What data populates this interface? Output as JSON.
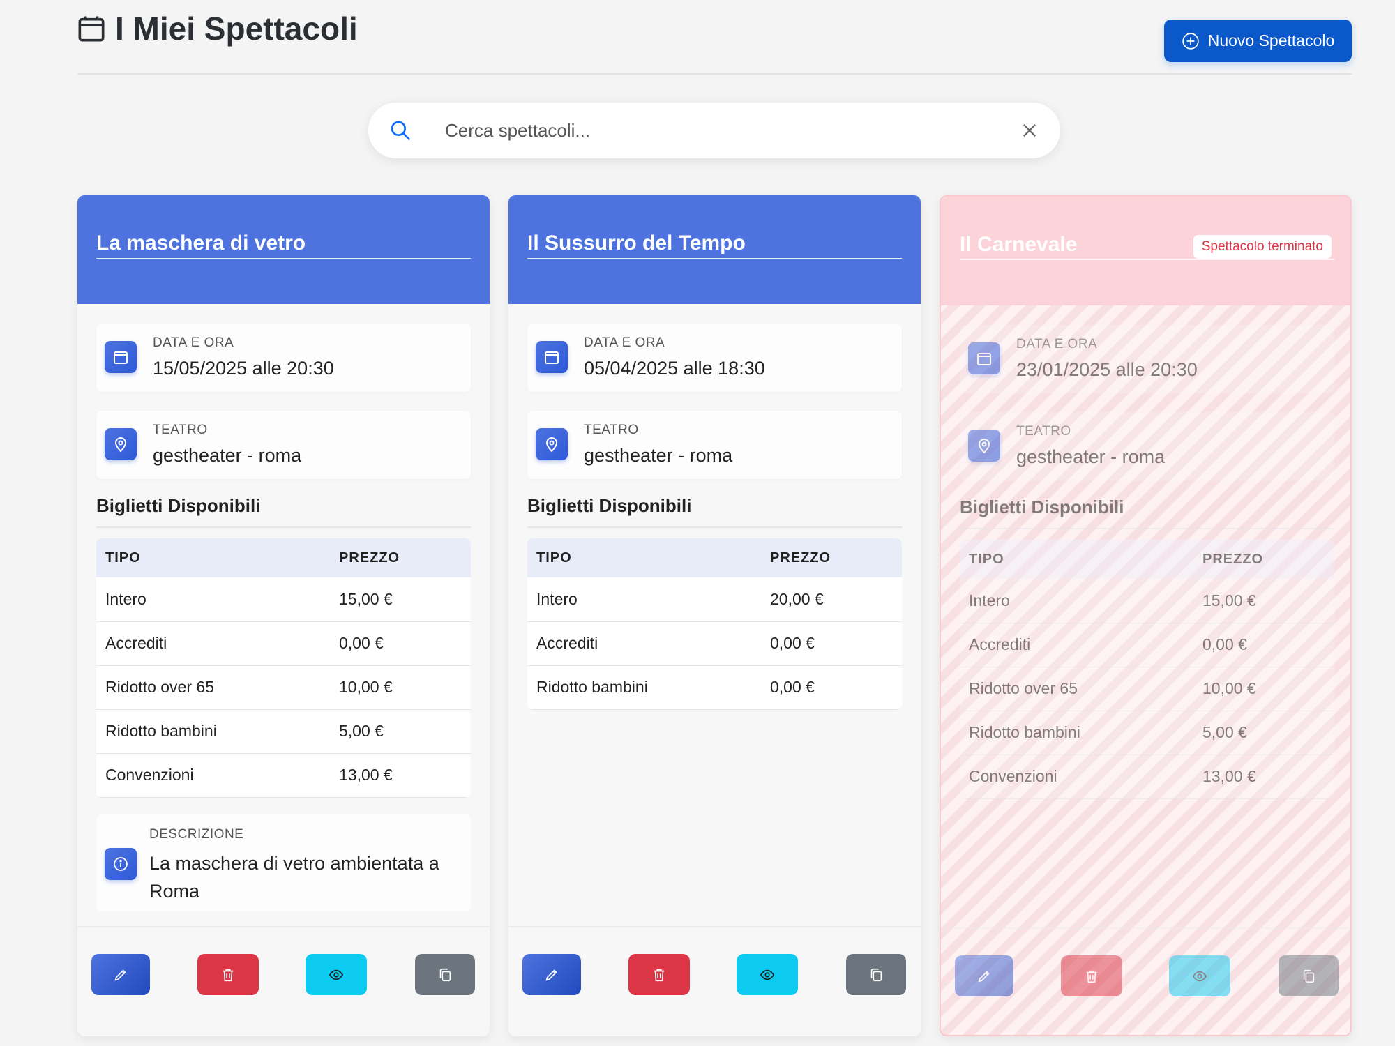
{
  "header": {
    "title": "I Miei Spettacoli",
    "new_button": "Nuovo Spettacolo"
  },
  "search": {
    "placeholder": "Cerca spettacoli..."
  },
  "labels": {
    "date": "DATA E ORA",
    "theater": "TEATRO",
    "tickets_title": "Biglietti Disponibili",
    "col_type": "TIPO",
    "col_price": "PREZZO",
    "description": "DESCRIZIONE"
  },
  "shows": [
    {
      "title": "La maschera di vetro",
      "datetime": "15/05/2025 alle 20:30",
      "theater": "gestheater - roma",
      "tickets": [
        {
          "type": "Intero",
          "price": "15,00 €"
        },
        {
          "type": "Accrediti",
          "price": "0,00 €"
        },
        {
          "type": "Ridotto over 65",
          "price": "10,00 €"
        },
        {
          "type": "Ridotto bambini",
          "price": "5,00 €"
        },
        {
          "type": "Convenzioni",
          "price": "13,00 €"
        }
      ],
      "description": "La maschera di vetro ambientata a Roma"
    },
    {
      "title": "Il Sussurro del Tempo",
      "datetime": "05/04/2025 alle 18:30",
      "theater": "gestheater - roma",
      "tickets": [
        {
          "type": "Intero",
          "price": "20,00 €"
        },
        {
          "type": "Accrediti",
          "price": "0,00 €"
        },
        {
          "type": "Ridotto bambini",
          "price": "0,00 €"
        }
      ]
    },
    {
      "title": "Il Carnevale",
      "status": "Spettacolo terminato",
      "datetime": "23/01/2025 alle 20:30",
      "theater": "gestheater - roma",
      "tickets": [
        {
          "type": "Intero",
          "price": "15,00 €"
        },
        {
          "type": "Accrediti",
          "price": "0,00 €"
        },
        {
          "type": "Ridotto over 65",
          "price": "10,00 €"
        },
        {
          "type": "Ridotto bambini",
          "price": "5,00 €"
        },
        {
          "type": "Convenzioni",
          "price": "13,00 €"
        }
      ]
    }
  ],
  "colors": {
    "primary": "#4e73df",
    "ended_header": "#fbd3d8",
    "danger": "#dc3545",
    "info": "#0dcaf0",
    "secondary": "#6c757d",
    "new_button": "#0a58ca"
  },
  "icons": {
    "title": "calendar-icon",
    "new_button": "plus-circle-icon",
    "search": "search-icon",
    "clear": "close-icon",
    "date": "calendar-icon",
    "theater": "location-pin-icon",
    "description": "info-icon",
    "edit": "pencil-icon",
    "delete": "trash-icon",
    "view": "eye-icon",
    "copy": "copy-icon"
  }
}
